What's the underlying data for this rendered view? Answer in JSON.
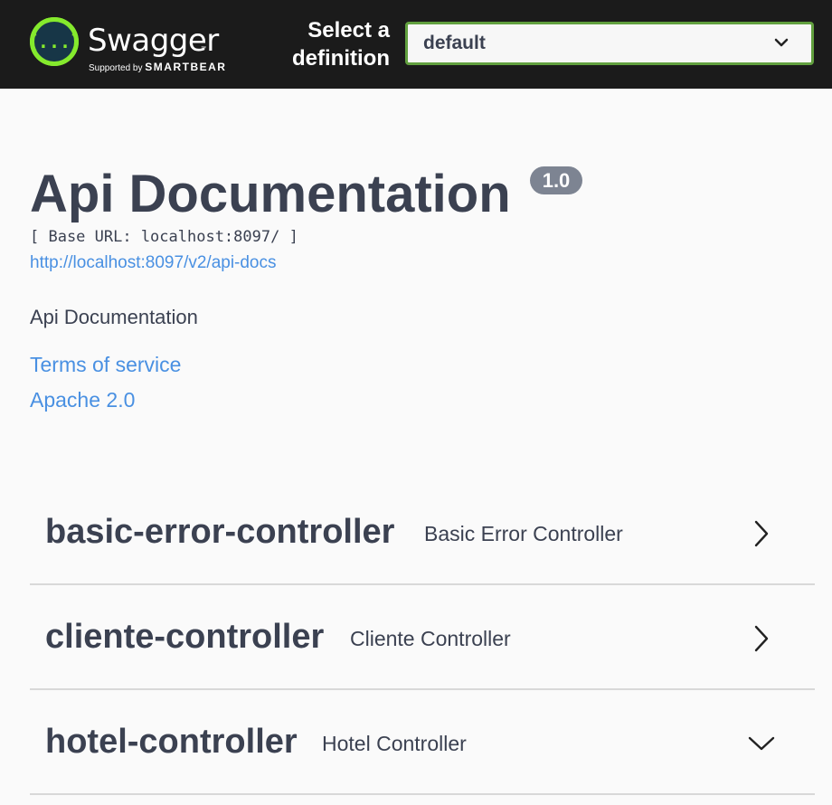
{
  "topbar": {
    "logo": {
      "name": "Swagger",
      "trademark": "™",
      "supported_by": "Supported by",
      "company": "SMARTBEAR",
      "glyph": "{...}"
    },
    "definition_label": "Select a definition",
    "definition_selected": "default",
    "chevron_icon": "chevron-down-icon"
  },
  "info": {
    "title": "Api Documentation",
    "version": "1.0",
    "base_url": "[ Base URL: localhost:8097/ ]",
    "api_docs_url": "http://localhost:8097/v2/api-docs",
    "description": "Api Documentation",
    "terms_of_service": "Terms of service",
    "license": "Apache 2.0"
  },
  "tags": [
    {
      "name": "basic-error-controller",
      "description": "Basic Error Controller",
      "expanded": false,
      "toggle_icon": "chevron-right-icon"
    },
    {
      "name": "cliente-controller",
      "description": "Cliente Controller",
      "expanded": false,
      "toggle_icon": "chevron-right-icon"
    },
    {
      "name": "hotel-controller",
      "description": "Hotel Controller",
      "expanded": true,
      "toggle_icon": "chevron-down-icon"
    }
  ],
  "colors": {
    "topbar_bg": "#1b1b1b",
    "logo_green": "#85ea2d",
    "select_border": "#62a03f",
    "text": "#3b4151",
    "link": "#4990e2",
    "version_badge": "#7d8492"
  }
}
